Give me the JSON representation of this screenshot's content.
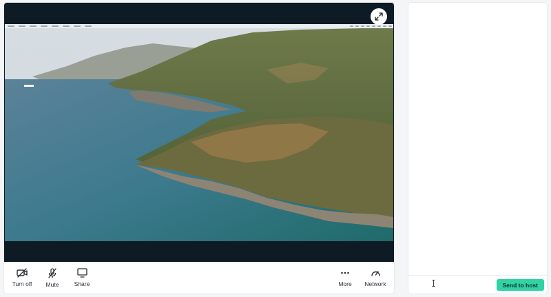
{
  "toolbar": {
    "camera": {
      "label": "Turn off",
      "icon": "camera-off-icon"
    },
    "mic": {
      "label": "Mute",
      "icon": "mic-off-icon"
    },
    "share": {
      "label": "Share",
      "icon": "monitor-icon"
    },
    "more": {
      "label": "More",
      "icon": "more-dots-icon"
    },
    "network": {
      "label": "Network",
      "icon": "speedometer-icon"
    }
  },
  "video": {
    "expand_icon": "expand-icon",
    "content": "shared-screen-coastal-landscape"
  },
  "chat": {
    "input_value": "",
    "input_placeholder": "",
    "send_label": "Send to host",
    "send_color": "#31d3a5"
  }
}
